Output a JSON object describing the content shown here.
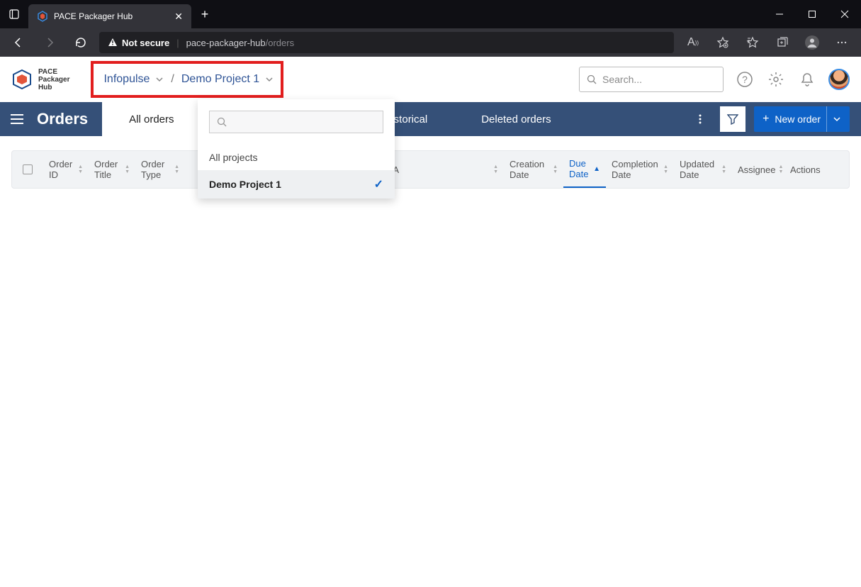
{
  "browser": {
    "tab_title": "PACE Packager Hub",
    "security_label": "Not secure",
    "url_host": "pace-packager-hub",
    "url_path": "/orders"
  },
  "header": {
    "logo_line1": "PACE",
    "logo_line2": "Packager",
    "logo_line3": "Hub",
    "breadcrumb": {
      "org": "Infopulse",
      "project": "Demo Project 1"
    },
    "search_placeholder": "Search..."
  },
  "dropdown": {
    "all_label": "All projects",
    "items": [
      {
        "label": "Demo Project 1",
        "selected": true
      }
    ]
  },
  "nav": {
    "title": "Orders",
    "tabs": {
      "all": "All orders",
      "historical": "Historical",
      "deleted": "Deleted orders"
    },
    "new_order": "New order"
  },
  "table": {
    "cols": {
      "order_id": "Order ID",
      "order_title": "Order Title",
      "order_type": "Order Type",
      "sla": "A",
      "creation": "Creation Date",
      "due": "Due Date",
      "completion": "Completion Date",
      "updated": "Updated Date",
      "assignee": "Assignee",
      "actions": "Actions"
    }
  }
}
